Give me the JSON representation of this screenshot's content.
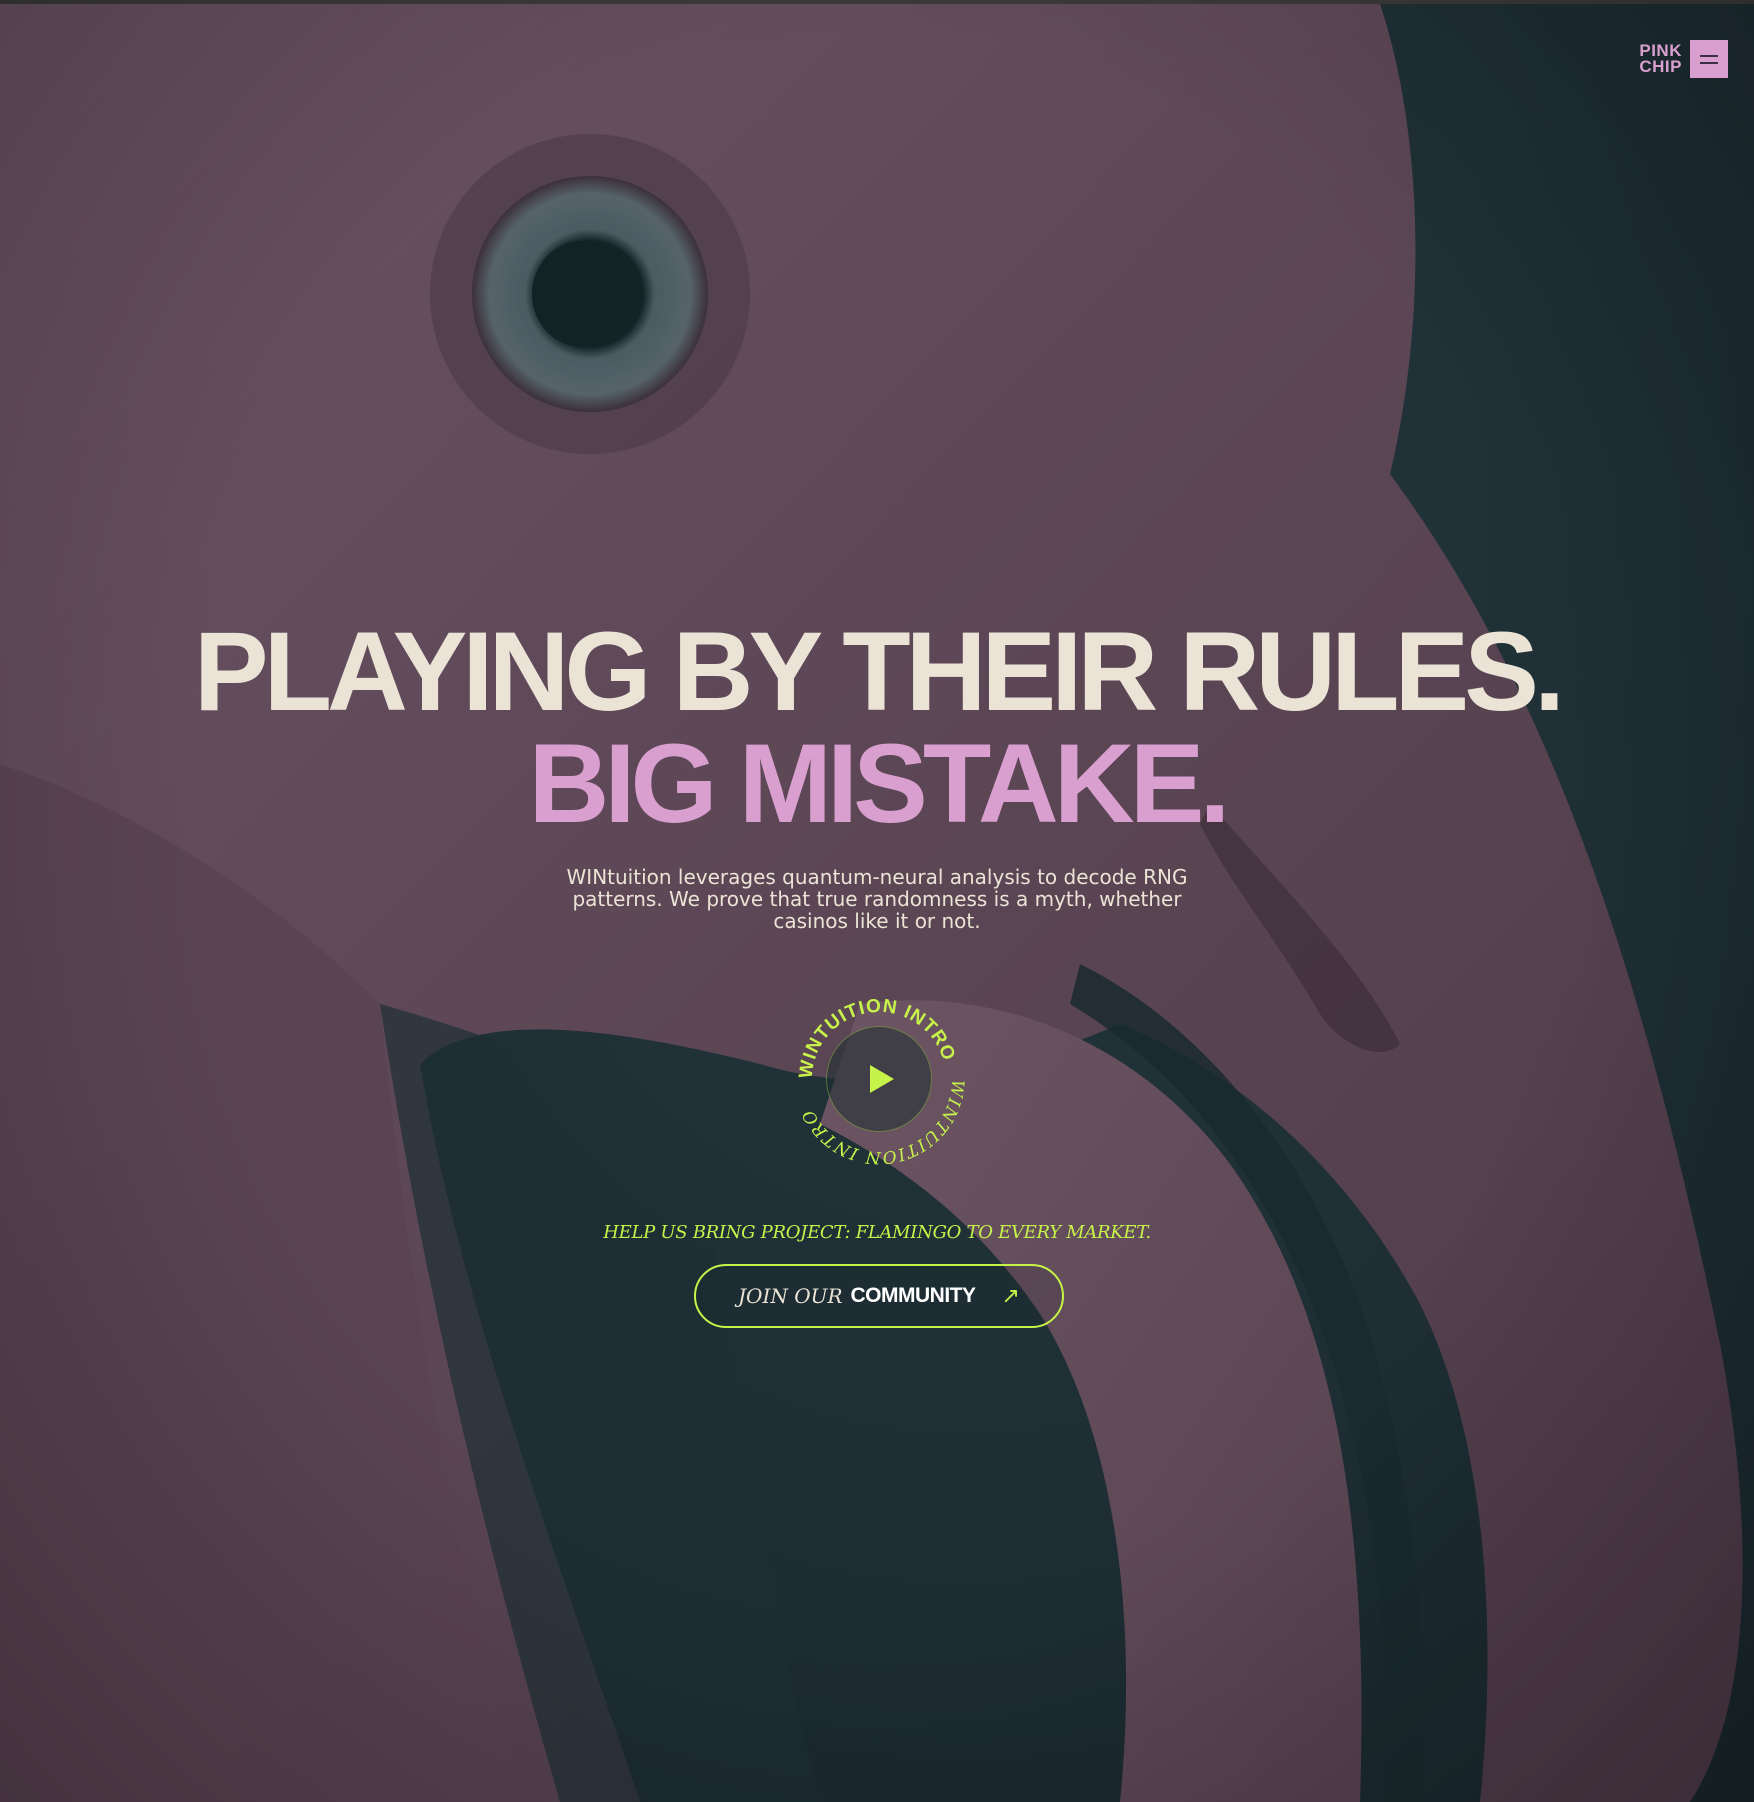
{
  "brand": {
    "line1": "PINK",
    "line2": "CHIP"
  },
  "menu": {
    "icon": "hamburger-icon"
  },
  "hero": {
    "headline_line1": "PLAYING BY THEIR RULES.",
    "headline_line2": "BIG MISTAKE.",
    "description": "WINtuition leverages quantum-neural analysis to decode RNG patterns. We prove that true randomness is a myth, whether casinos like it or not."
  },
  "intro_video": {
    "ring_text_top": "WINTUITION INTRO",
    "ring_text_bottom": "WINTUITION INTRO",
    "icon": "play-icon"
  },
  "cta": {
    "note": "HELP US BRING PROJECT: FLAMINGO TO EVERY MARKET.",
    "button_prefix": "JOIN OUR",
    "button_strong": "COMMUNITY",
    "button_icon": "arrow-up-right-icon"
  },
  "colors": {
    "accent_lime": "#c6f24a",
    "pink": "#d9a0cf",
    "cream": "#ebe4d6",
    "bg_teal": "#1f3036",
    "flamingo": "#5b4654"
  }
}
